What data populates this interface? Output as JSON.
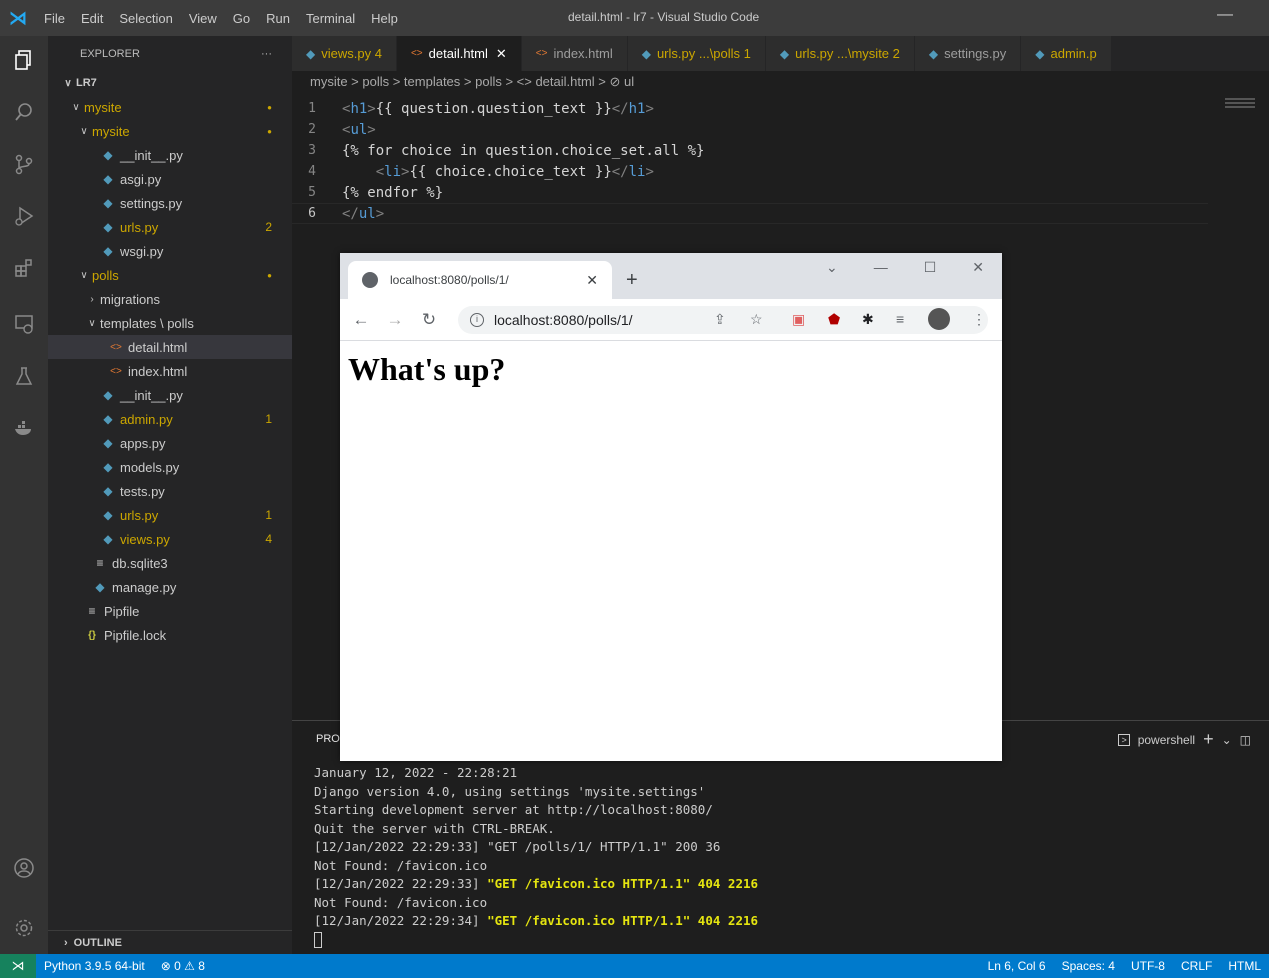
{
  "titlebar": {
    "menu": [
      "File",
      "Edit",
      "Selection",
      "View",
      "Go",
      "Run",
      "Terminal",
      "Help"
    ],
    "window_title": "detail.html - lr7 - Visual Studio Code"
  },
  "explorer": {
    "header": "EXPLORER",
    "more": "···",
    "root": "LR7",
    "items": [
      {
        "label": "mysite",
        "depth": 1,
        "type": "folder",
        "modified": true
      },
      {
        "label": "mysite",
        "depth": 2,
        "type": "folder",
        "modified": true
      },
      {
        "label": "__init__.py",
        "depth": 3,
        "type": "py"
      },
      {
        "label": "asgi.py",
        "depth": 3,
        "type": "py"
      },
      {
        "label": "settings.py",
        "depth": 3,
        "type": "py"
      },
      {
        "label": "urls.py",
        "depth": 3,
        "type": "py",
        "badge": "2",
        "modified": true
      },
      {
        "label": "wsgi.py",
        "depth": 3,
        "type": "py"
      },
      {
        "label": "polls",
        "depth": 2,
        "type": "folder",
        "modified": true
      },
      {
        "label": "migrations",
        "depth": 3,
        "type": "folder-closed"
      },
      {
        "label": "templates \\ polls",
        "depth": 3,
        "type": "folder"
      },
      {
        "label": "detail.html",
        "depth": 4,
        "type": "html",
        "selected": true
      },
      {
        "label": "index.html",
        "depth": 4,
        "type": "html"
      },
      {
        "label": "__init__.py",
        "depth": 3,
        "type": "py"
      },
      {
        "label": "admin.py",
        "depth": 3,
        "type": "py",
        "badge": "1",
        "modified": true
      },
      {
        "label": "apps.py",
        "depth": 3,
        "type": "py"
      },
      {
        "label": "models.py",
        "depth": 3,
        "type": "py"
      },
      {
        "label": "tests.py",
        "depth": 3,
        "type": "py"
      },
      {
        "label": "urls.py",
        "depth": 3,
        "type": "py",
        "badge": "1",
        "modified": true
      },
      {
        "label": "views.py",
        "depth": 3,
        "type": "py",
        "badge": "4",
        "modified": true
      },
      {
        "label": "db.sqlite3",
        "depth": 2,
        "type": "db"
      },
      {
        "label": "manage.py",
        "depth": 2,
        "type": "py"
      },
      {
        "label": "Pipfile",
        "depth": 1,
        "type": "db"
      },
      {
        "label": "Pipfile.lock",
        "depth": 1,
        "type": "json"
      }
    ],
    "outline": "OUTLINE"
  },
  "tabs": [
    {
      "label": "views.py 4",
      "icon": "python-icon",
      "modified": true
    },
    {
      "label": "detail.html",
      "icon": "html-icon",
      "active": true
    },
    {
      "label": "index.html",
      "icon": "html-icon"
    },
    {
      "label": "urls.py ...\\polls 1",
      "icon": "python-icon",
      "modified": true
    },
    {
      "label": "urls.py ...\\mysite 2",
      "icon": "python-icon",
      "modified": true
    },
    {
      "label": "settings.py",
      "icon": "python-icon"
    },
    {
      "label": "admin.p",
      "icon": "python-icon",
      "modified": true
    }
  ],
  "breadcrumb": "mysite > polls > templates > polls > <> detail.html > ⊘ ul",
  "code_lines": [
    "<h1>{{ question.question_text }}</h1>",
    "<ul>",
    "{% for choice in question.choice_set.all %}",
    "    <li>{{ choice.choice_text }}</li>",
    "{% endfor %}",
    "</ul>"
  ],
  "panel": {
    "title": "PRO",
    "shell": "powershell",
    "terminal_lines": [
      {
        "text": "January 12, 2022 - 22:28:21"
      },
      {
        "text": "Django version 4.0, using settings 'mysite.settings'"
      },
      {
        "text": "Starting development server at http://localhost:8080/"
      },
      {
        "text": "Quit the server with CTRL-BREAK."
      },
      {
        "text": "[12/Jan/2022 22:29:33] \"GET /polls/1/ HTTP/1.1\" 200 36"
      },
      {
        "text": "Not Found: /favicon.ico"
      },
      {
        "prefix": "[12/Jan/2022 22:29:33] ",
        "highlight": "\"GET /favicon.ico HTTP/1.1\" 404 2216"
      },
      {
        "text": "Not Found: /favicon.ico"
      },
      {
        "prefix": "[12/Jan/2022 22:29:34] ",
        "highlight": "\"GET /favicon.ico HTTP/1.1\" 404 2216"
      }
    ]
  },
  "statusbar": {
    "python": "Python 3.9.5 64-bit",
    "problems": "⊗ 0 ⚠ 8",
    "position": "Ln 6, Col 6",
    "spaces": "Spaces: 4",
    "encoding": "UTF-8",
    "eol": "CRLF",
    "language": "HTML"
  },
  "browser": {
    "tab_title": "localhost:8080/polls/1/",
    "url": "localhost:8080/polls/1/",
    "heading": "What's up?"
  },
  "colors": {
    "accent": "#007acc",
    "modified": "#cca700",
    "remote": "#16825d"
  }
}
